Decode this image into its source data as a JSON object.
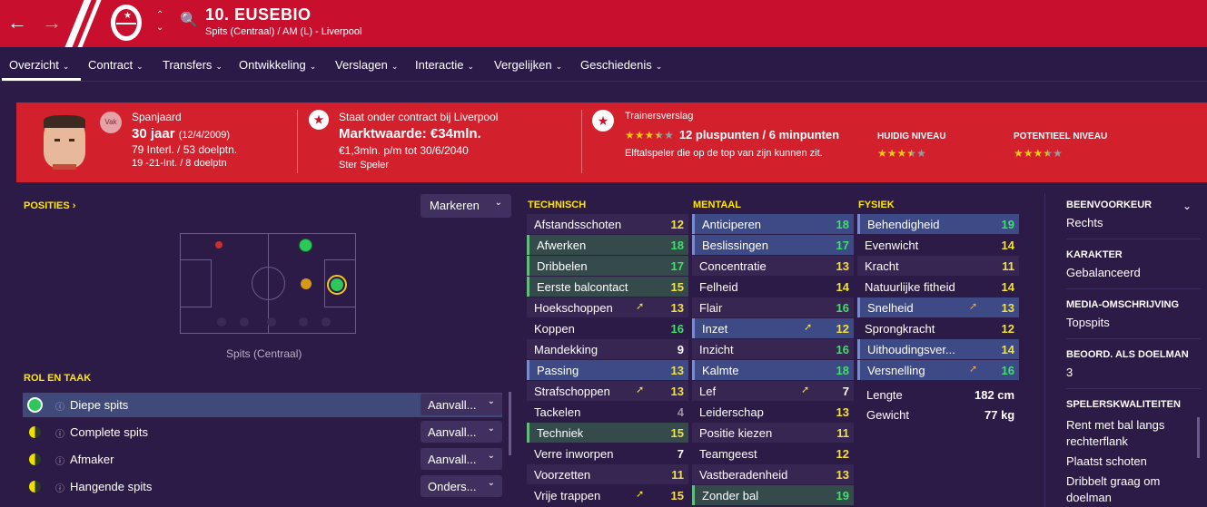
{
  "header": {
    "player_name": "10. EUSEBIO",
    "subtitle": "Spits (Centraal) / AM (L) - Liverpool",
    "icons": [
      "back-arrow-icon",
      "forward-arrow-icon",
      "club-badge",
      "up-down-icon",
      "search-icon"
    ],
    "colors": {
      "brand_red": "#c8102e",
      "background": "#2d1b47"
    }
  },
  "menu": [
    "Overzicht",
    "Contract",
    "Transfers",
    "Ontwikkeling",
    "Verslagen",
    "Interactie",
    "Vergelijken",
    "Geschiedenis"
  ],
  "card": {
    "badge": "Vak",
    "nationality": "Spanjaard",
    "age": "30 jaar",
    "dob": "(12/4/2009)",
    "intl": "79 Interl. / 53 doelptn.",
    "u21": "19 -21-Int. / 8 doelptn",
    "contract_title": "Staat onder contract bij Liverpool",
    "market_value": "Marktwaarde: €34mln.",
    "wage": "€1,3mln. p/m tot 30/6/2040",
    "status": "Ster Speler",
    "report_title": "Trainersverslag",
    "report_rating": 3.5,
    "report_points": "12 pluspunten / 6 minpunten",
    "report_desc": "Elftalspeler die op de top van zijn kunnen zit.",
    "current_label": "HUIDIG NIVEAU",
    "current_rating": 3.5,
    "potential_label": "POTENTIEEL NIVEAU",
    "potential_rating": 3.5
  },
  "positions": {
    "title": "POSITIES",
    "marker_btn": "Markeren",
    "pitch_label": "Spits (Centraal)"
  },
  "roles": {
    "title": "ROL EN TAAK",
    "items": [
      {
        "name": "Diepe spits",
        "duty": "Aanvall..."
      },
      {
        "name": "Complete spits",
        "duty": "Aanvall..."
      },
      {
        "name": "Afmaker",
        "duty": "Aanvall..."
      },
      {
        "name": "Hangende spits",
        "duty": "Onders..."
      }
    ]
  },
  "technical": {
    "title": "TECHNISCH",
    "rows": [
      {
        "name": "Afstandsschoten",
        "value": "12"
      },
      {
        "name": "Afwerken",
        "value": "18"
      },
      {
        "name": "Dribbelen",
        "value": "17"
      },
      {
        "name": "Eerste balcontact",
        "value": "15"
      },
      {
        "name": "Hoekschoppen",
        "value": "13"
      },
      {
        "name": "Koppen",
        "value": "16"
      },
      {
        "name": "Mandekking",
        "value": "9"
      },
      {
        "name": "Passing",
        "value": "13"
      },
      {
        "name": "Strafschoppen",
        "value": "13"
      },
      {
        "name": "Tackelen",
        "value": "4"
      },
      {
        "name": "Techniek",
        "value": "15"
      },
      {
        "name": "Verre inworpen",
        "value": "7"
      },
      {
        "name": "Voorzetten",
        "value": "11"
      },
      {
        "name": "Vrije trappen",
        "value": "15"
      }
    ]
  },
  "mental": {
    "title": "MENTAAL",
    "rows": [
      {
        "name": "Anticiperen",
        "value": "18"
      },
      {
        "name": "Beslissingen",
        "value": "17"
      },
      {
        "name": "Concentratie",
        "value": "13"
      },
      {
        "name": "Felheid",
        "value": "14"
      },
      {
        "name": "Flair",
        "value": "16"
      },
      {
        "name": "Inzet",
        "value": "12"
      },
      {
        "name": "Inzicht",
        "value": "16"
      },
      {
        "name": "Kalmte",
        "value": "18"
      },
      {
        "name": "Lef",
        "value": "7"
      },
      {
        "name": "Leiderschap",
        "value": "13"
      },
      {
        "name": "Positie kiezen",
        "value": "11"
      },
      {
        "name": "Teamgeest",
        "value": "12"
      },
      {
        "name": "Vastberadenheid",
        "value": "13"
      },
      {
        "name": "Zonder bal",
        "value": "19"
      }
    ]
  },
  "physical": {
    "title": "FYSIEK",
    "rows": [
      {
        "name": "Behendigheid",
        "value": "19"
      },
      {
        "name": "Evenwicht",
        "value": "14"
      },
      {
        "name": "Kracht",
        "value": "11"
      },
      {
        "name": "Natuurlijke fitheid",
        "value": "14"
      },
      {
        "name": "Snelheid",
        "value": "13"
      },
      {
        "name": "Sprongkracht",
        "value": "12"
      },
      {
        "name": "Uithoudingsver...",
        "value": "14"
      },
      {
        "name": "Versnelling",
        "value": "16"
      }
    ],
    "height_label": "Lengte",
    "height": "182 cm",
    "weight_label": "Gewicht",
    "weight": "77 kg"
  },
  "info": {
    "foot_label": "BEENVOORKEUR",
    "foot": "Rechts",
    "char_label": "KARAKTER",
    "char": "Gebalanceerd",
    "media_label": "MEDIA-OMSCHRIJVING",
    "media": "Topspits",
    "gk_label": "BEOORD. ALS DOELMAN",
    "gk": "3",
    "traits_label": "SPELERSKWALITEITEN",
    "traits": [
      "Rent met bal langs",
      "rechterflank",
      "Plaatst schoten",
      "Dribbelt graag om",
      "doelman"
    ]
  }
}
